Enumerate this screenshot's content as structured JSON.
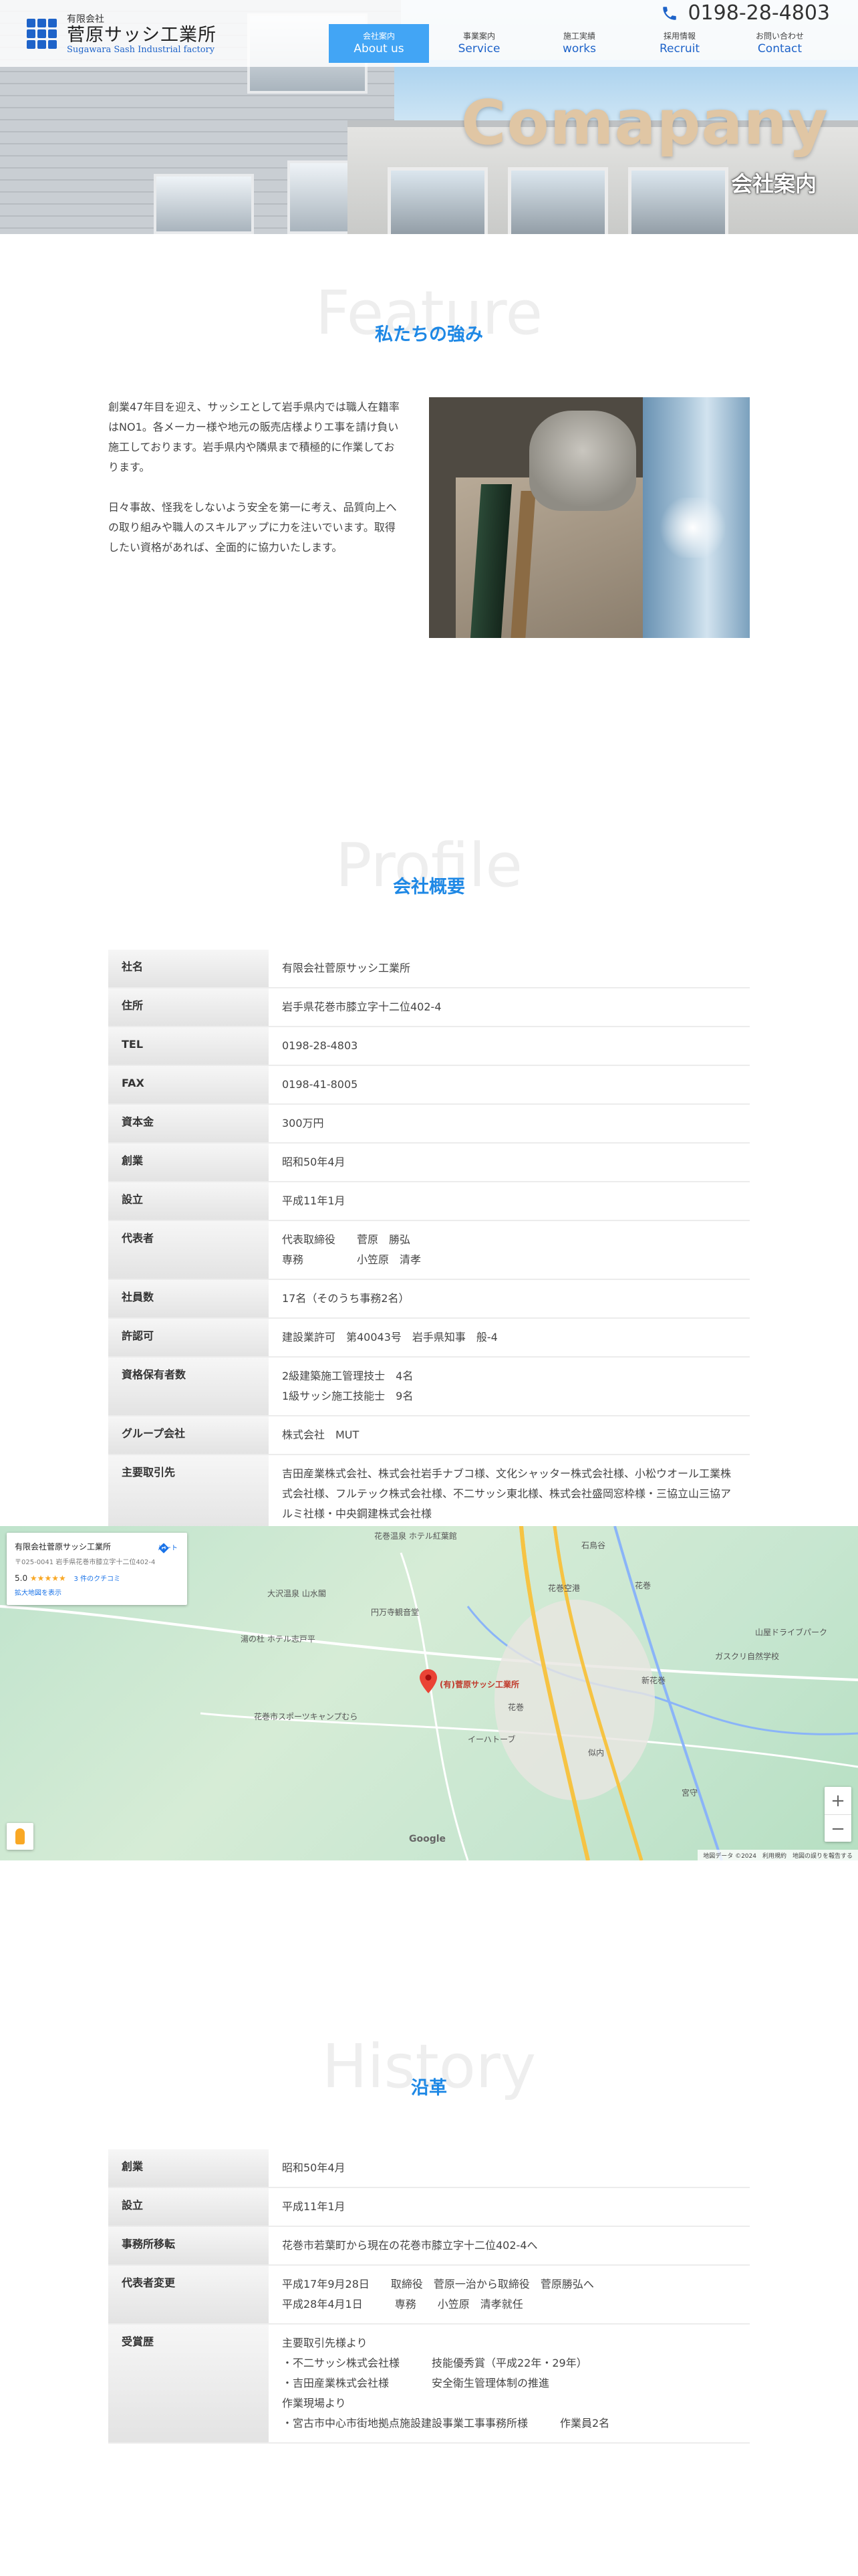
{
  "header": {
    "logo_small": "有限会社",
    "logo_main": "菅原サッシ工業所",
    "logo_en": "Sugawara Sash Industrial factory",
    "phone": "0198-28-4803",
    "nav": [
      {
        "jp": "会社案内",
        "en": "About us",
        "active": true
      },
      {
        "jp": "事業案内",
        "en": "Service",
        "active": false
      },
      {
        "jp": "施工実績",
        "en": "works",
        "active": false
      },
      {
        "jp": "採用情報",
        "en": "Recruit",
        "active": false
      },
      {
        "jp": "お問い合わせ",
        "en": "Contact",
        "active": false
      }
    ]
  },
  "hero": {
    "title": "Comapany",
    "subtitle": "会社案内"
  },
  "feature": {
    "ghost": "Feature",
    "title": "私たちの強み",
    "paragraphs": [
      "創業47年目を迎え、サッシエとして岩手県内では職人在籍率はNO1。各メーカー様や地元の販売店様よりエ事を請け負い施工しております。岩手県内や隣県まで積極的に作業しております。",
      "日々事故、怪我をしないよう安全を第一に考え、品質向上への取り組みや職人のスキルアップに力を注いでいます。取得したい資格があれば、全面的に協力いたします。"
    ]
  },
  "profile": {
    "ghost": "Profile",
    "title": "会社概要",
    "rows": [
      {
        "label": "社名",
        "lines": [
          "有限会社菅原サッシ工業所"
        ]
      },
      {
        "label": "住所",
        "lines": [
          "岩手県花巻市膝立字十二位402-4"
        ]
      },
      {
        "label": "TEL",
        "lines": [
          "0198-28-4803"
        ]
      },
      {
        "label": "FAX",
        "lines": [
          "0198-41-8005"
        ]
      },
      {
        "label": "資本金",
        "lines": [
          "300万円"
        ]
      },
      {
        "label": "創業",
        "lines": [
          "昭和50年4月"
        ]
      },
      {
        "label": "設立",
        "lines": [
          "平成11年1月"
        ]
      },
      {
        "label": "代表者",
        "lines": [
          "代表取締役　　菅原　勝弘",
          "専務　　　　　小笠原　清孝"
        ]
      },
      {
        "label": "社員数",
        "lines": [
          "17名（そのうち事務2名）"
        ]
      },
      {
        "label": "許認可",
        "lines": [
          "建設業許可　第40043号　岩手県知事　般-4"
        ]
      },
      {
        "label": "資格保有者数",
        "lines": [
          "2級建築施工管理技士　4名",
          "1級サッシ施工技能士　9名"
        ]
      },
      {
        "label": "グループ会社",
        "lines": [
          "株式会社　MUT"
        ]
      },
      {
        "label": "主要取引先",
        "lines": [
          "吉田産業株式会社、株式会社岩手ナブコ様、文化シャッター株式会社様、小松ウオール工業株式会社様、フルテック株式会社様、不二サッシ東北様、株式会社盛岡窓枠様・三協立山三協アルミ社様・中央鋼建株式会社様"
        ]
      }
    ]
  },
  "map": {
    "card_name": "有限会社菅原サッシ工業所",
    "card_addr": "〒025-0041 岩手県花巻市膝立字十二位402-4",
    "rating": "5.0",
    "stars": "★★★★★",
    "review_count": "3 件のクチコミ",
    "enlarge_link": "拡大地図を表示",
    "directions": "ルート",
    "pin_label": "(有)菅原サッシ工業所",
    "labels": [
      "花巻温泉 ホテル紅葉館",
      "大沢温泉 山水閣",
      "花巻空港",
      "花巻",
      "湯の杜 ホテル志戸平",
      "円万寺観音堂",
      "花巻市スポーツキャンプむら",
      "新花巻",
      "イーハトーブ",
      "山屋ドライブパーク",
      "ガスクリ自然学校",
      "似内",
      "花巻",
      "宮守",
      "石鳥谷"
    ],
    "google": "Google",
    "footer": "地図データ ©2024　利用規約　地図の誤りを報告する"
  },
  "history": {
    "ghost": "History",
    "title": "沿革",
    "rows": [
      {
        "label": "創業",
        "lines": [
          "昭和50年4月"
        ]
      },
      {
        "label": "設立",
        "lines": [
          "平成11年1月"
        ]
      },
      {
        "label": "事務所移転",
        "lines": [
          "花巻市若葉町から現在の花巻市膝立字十二位402-4へ"
        ]
      },
      {
        "label": "代表者変更",
        "lines": [
          "平成17年9月28日　　取締役　菅原一治から取締役　菅原勝弘へ",
          "平成28年4月1日　　　専務　　小笠原　清孝就任"
        ]
      },
      {
        "label": "受賞歴",
        "lines": [
          "主要取引先様より",
          "・不二サッシ株式会社様　　　技能優秀賞（平成22年・29年）",
          "・吉田産業株式会社様　　　　安全衛生管理体制の推進",
          "作業現場より",
          "・宮古市中心市街地拠点施設建設事業工事事務所様　　　作業員2名"
        ]
      }
    ]
  },
  "colors": {
    "accent": "#1e88e5",
    "nav_active": "#42a5f5",
    "logo_blue": "#1e63c9",
    "hero_title": "#e0c6a4"
  }
}
